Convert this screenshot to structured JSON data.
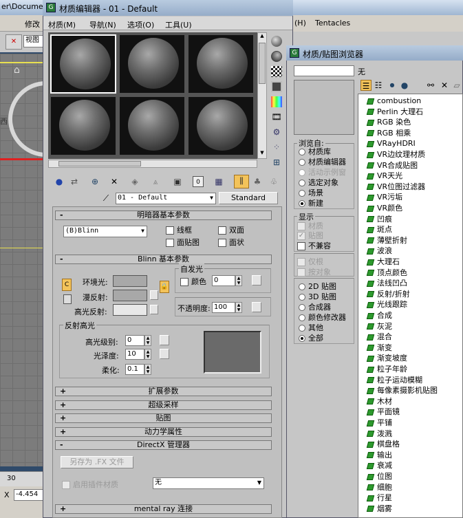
{
  "background": {
    "title_fragment": "er\\Docume",
    "menu_edit": "修改",
    "viewport_label": "视图",
    "menu_right": "Tentacles",
    "menu_h": "(H)",
    "ruler_30": "30",
    "x_label": "X",
    "x_value": "-4.454"
  },
  "mat_editor": {
    "title": "材质编辑器 - 01 - Default",
    "menu": [
      {
        "label": "材质(M)"
      },
      {
        "label": "导航(N)"
      },
      {
        "label": "选项(O)"
      },
      {
        "label": "工具(U)"
      }
    ],
    "material_name": "01 - Default",
    "material_type": "Standard",
    "rollouts": {
      "shader_basic": "明暗器基本参数",
      "blinn_basic": "Blinn 基本参数",
      "extended": "扩展参数",
      "supersampling": "超级采样",
      "maps": "贴图",
      "dynamics": "动力学属性",
      "directx": "DirectX 管理器",
      "mental_ray": "mental ray 连接"
    },
    "shader": {
      "type": "(B)Blinn",
      "wire": "线框",
      "two_sided": "双面",
      "face_map": "面贴图",
      "faceted": "面状"
    },
    "blinn": {
      "ambient": "环境光:",
      "diffuse": "漫反射:",
      "specular": "高光反射:",
      "self_illum_group": "自发光",
      "color_label": "颜色",
      "self_illum_value": "0",
      "opacity_label": "不透明度:",
      "opacity_value": "100",
      "lock_letter": "C"
    },
    "specular_highlights": {
      "group": "反射高光",
      "level_label": "高光级别:",
      "level_value": "0",
      "gloss_label": "光泽度:",
      "gloss_value": "10",
      "soften_label": "柔化:",
      "soften_value": "0.1"
    },
    "directx": {
      "save_fx": "另存为 .FX 文件",
      "enable_plugin": "启用插件材质",
      "plugin_value": "无"
    },
    "colors": {
      "ambient": "#a8a8a8",
      "diffuse": "#a8a8a8",
      "specular": "#e8e8e8",
      "highlight_curve": "#6a6a6a"
    }
  },
  "browser": {
    "title": "材质/贴图浏览器",
    "name_value": "无",
    "browse_from": {
      "group": "浏览自:",
      "options": [
        {
          "label": "材质库",
          "selected": false,
          "disabled": false
        },
        {
          "label": "材质编辑器",
          "selected": false,
          "disabled": false
        },
        {
          "label": "活动示例窗",
          "selected": false,
          "disabled": true
        },
        {
          "label": "选定对象",
          "selected": false,
          "disabled": false
        },
        {
          "label": "场景",
          "selected": false,
          "disabled": false
        },
        {
          "label": "新建",
          "selected": true,
          "disabled": false
        }
      ]
    },
    "show": {
      "group": "显示",
      "options": [
        {
          "label": "材质",
          "checked": false,
          "disabled": true
        },
        {
          "label": "贴图",
          "checked": true,
          "disabled": true
        },
        {
          "label": "不兼容",
          "checked": false,
          "disabled": false
        }
      ]
    },
    "root": {
      "options": [
        {
          "label": "仅根",
          "disabled": true
        },
        {
          "label": "按对象",
          "disabled": true
        }
      ]
    },
    "map_filter": {
      "options": [
        {
          "label": "2D 贴图",
          "selected": false
        },
        {
          "label": "3D 贴图",
          "selected": false
        },
        {
          "label": "合成器",
          "selected": false
        },
        {
          "label": "颜色修改器",
          "selected": false
        },
        {
          "label": "其他",
          "selected": false
        },
        {
          "label": "全部",
          "selected": true
        }
      ]
    },
    "items": [
      "combustion",
      "Perlin 大理石",
      "RGB 染色",
      "RGB 相乘",
      "VRayHDRI",
      "VR边纹理材质",
      "VR合成贴图",
      "VR天光",
      "VR位图过滤器",
      "VR污垢",
      "VR颜色",
      "凹痕",
      "斑点",
      "薄壁折射",
      "波浪",
      "大理石",
      "顶点颜色",
      "法线凹凸",
      "反射/折射",
      "光线跟踪",
      "合成",
      "灰泥",
      "混合",
      "渐变",
      "渐变坡度",
      "粒子年龄",
      "粒子运动模糊",
      "每像素摄影机贴图",
      "木材",
      "平面镜",
      "平铺",
      "泼溅",
      "棋盘格",
      "输出",
      "衰减",
      "位图",
      "细胞",
      "行星",
      "烟雾"
    ]
  }
}
